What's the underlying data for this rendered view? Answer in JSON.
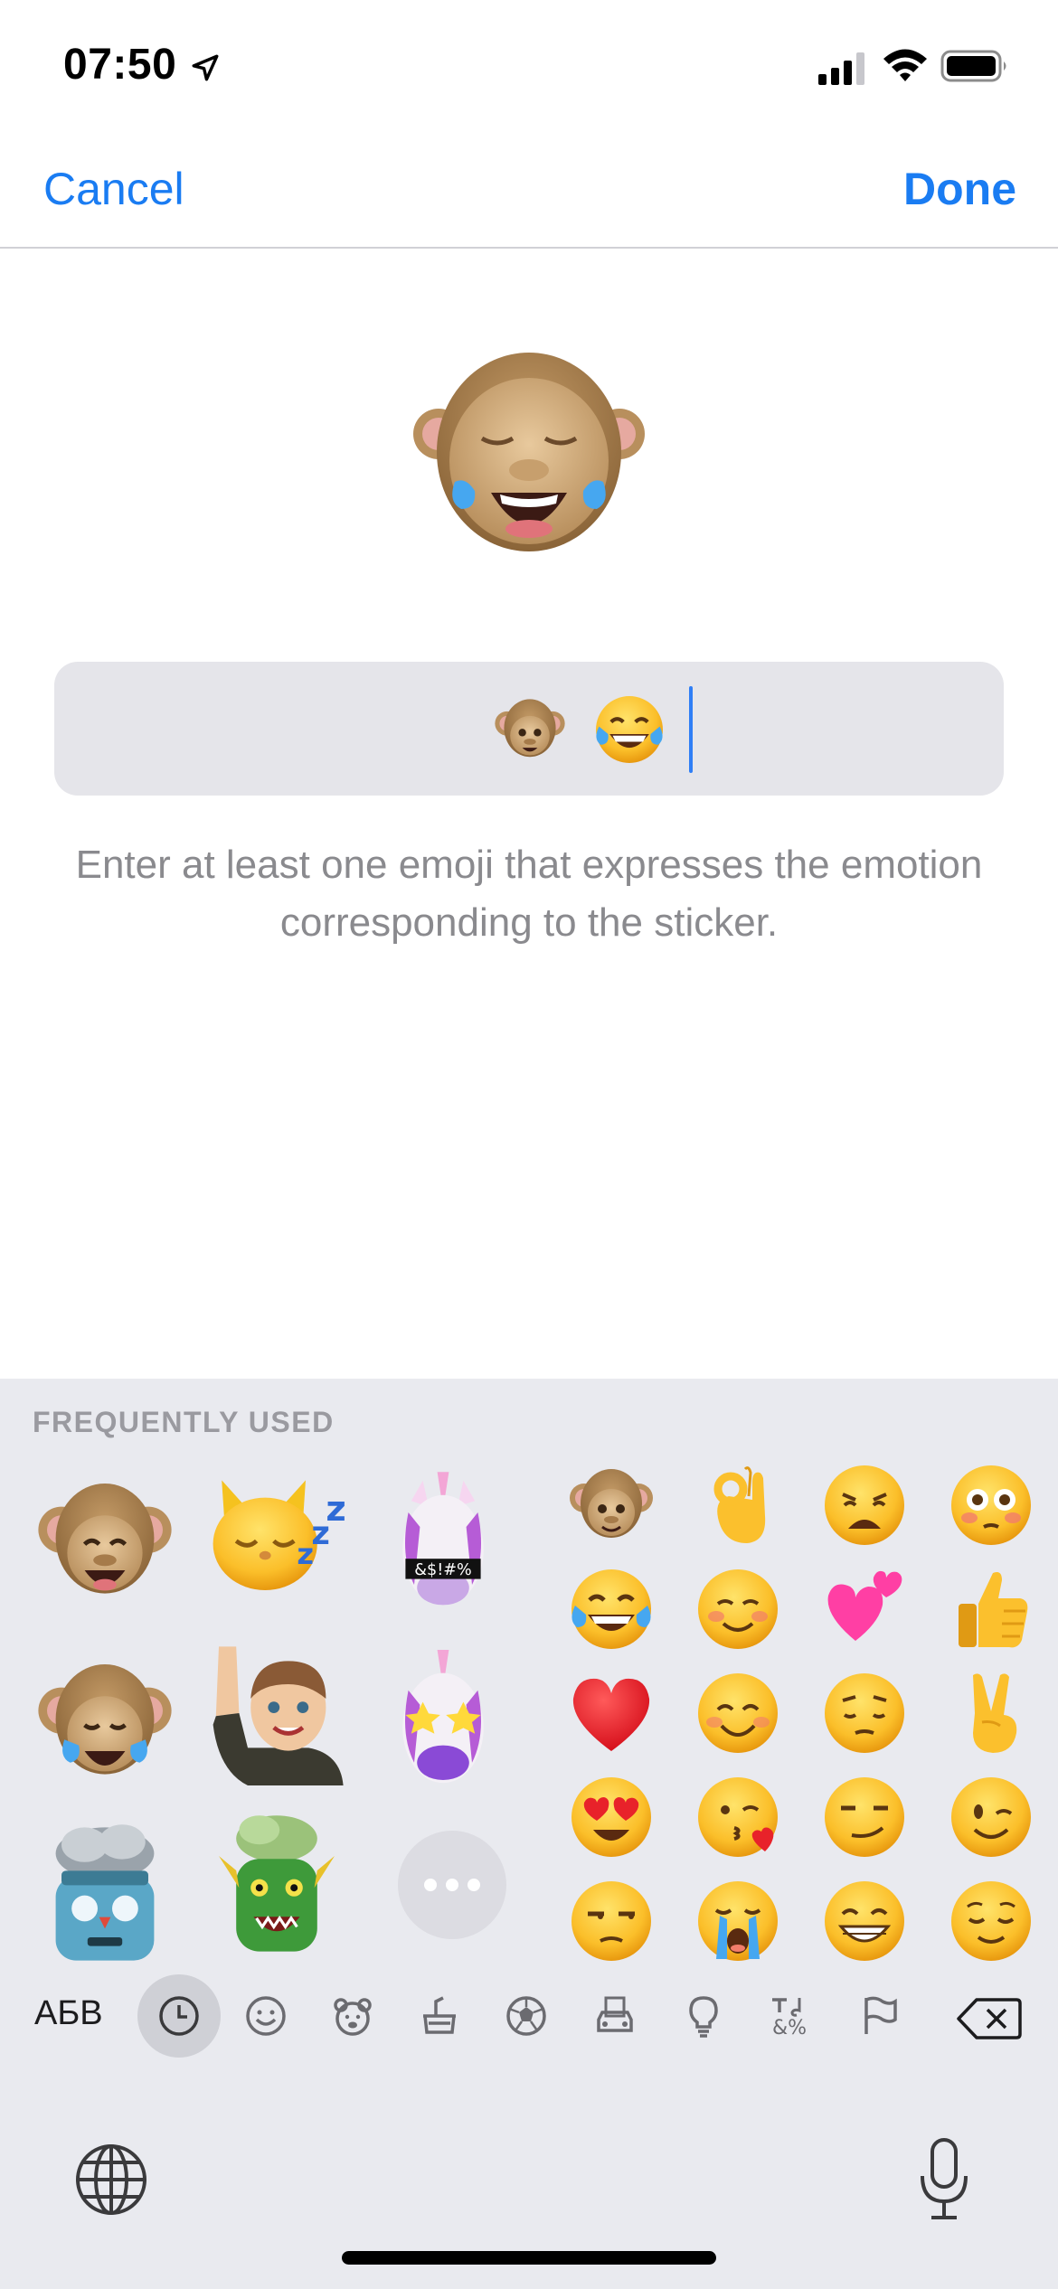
{
  "status_bar": {
    "time": "07:50"
  },
  "nav": {
    "cancel": "Cancel",
    "done": "Done"
  },
  "input": {
    "emojis": [
      "monkey-memoji",
      "tears-of-joy-emoji"
    ],
    "hint": "Enter at least one emoji that expresses the emotion corresponding to the sticker."
  },
  "keyboard": {
    "section_title": "FREQUENTLY USED",
    "layout_switch": "АБВ",
    "stickers": [
      "monkey-laughing-memoji",
      "cat-sleeping-memoji",
      "unicorn-cursing-memoji",
      "monkey-tears-memoji",
      "boy-waving-memoji",
      "unicorn-star-eyes-memoji",
      "robot-mind-blown-memoji",
      "dragon-mind-blown-memoji"
    ],
    "emoji_grid": [
      "monkey-face",
      "ok-hand",
      "weary-face",
      "flushed-face",
      "tears-of-joy",
      "smiling-face",
      "two-hearts",
      "thumbs-up",
      "red-heart",
      "smiling-eyes",
      "pensive-face",
      "victory-hand",
      "heart-eyes",
      "kissing-face-with-heart",
      "smirking-face",
      "winking-face",
      "unamused-face",
      "loudly-crying-face",
      "beaming-face",
      "relieved-face"
    ],
    "categories": [
      "recent-icon",
      "smileys-icon",
      "animals-icon",
      "food-icon",
      "activity-icon",
      "travel-icon",
      "objects-icon",
      "symbols-icon",
      "flags-icon"
    ],
    "active_category": "recent-icon"
  },
  "colors": {
    "accent": "#1a7cf2",
    "keyboard_bg": "#e9eaef",
    "field_bg": "#e5e5ea",
    "hint": "#8a8a8e"
  }
}
